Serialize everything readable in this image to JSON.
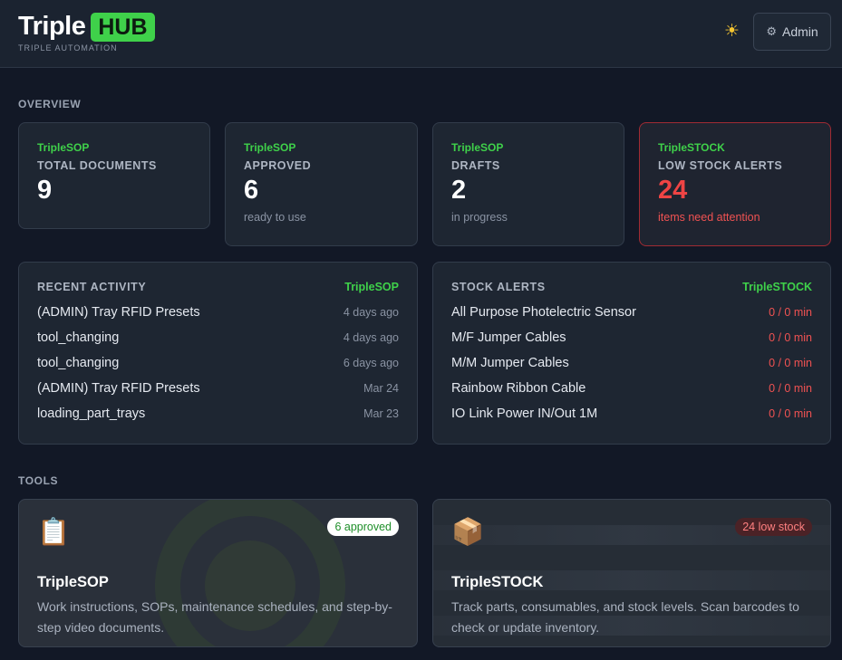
{
  "header": {
    "brand_name": "Triple",
    "brand_hub": "HUB",
    "brand_sub": "TRIPLE AUTOMATION",
    "theme_icon": "sun-icon",
    "admin_label": "Admin"
  },
  "overview": {
    "label": "OVERVIEW",
    "cards": [
      {
        "tag": "TripleSOP",
        "title": "TOTAL DOCUMENTS",
        "value": "9",
        "sub": ""
      },
      {
        "tag": "TripleSOP",
        "title": "APPROVED",
        "value": "6",
        "sub": "ready to use"
      },
      {
        "tag": "TripleSOP",
        "title": "DRAFTS",
        "value": "2",
        "sub": "in progress"
      },
      {
        "tag": "TripleSTOCK",
        "title": "LOW STOCK ALERTS",
        "value": "24",
        "sub": "items need attention"
      }
    ]
  },
  "recent": {
    "title": "RECENT ACTIVITY",
    "badge": "TripleSOP",
    "items": [
      {
        "name": "(ADMIN) Tray RFID Presets",
        "time": "4 days ago"
      },
      {
        "name": "tool_changing",
        "time": "4 days ago"
      },
      {
        "name": "tool_changing",
        "time": "6 days ago"
      },
      {
        "name": "(ADMIN) Tray RFID Presets",
        "time": "Mar 24"
      },
      {
        "name": "loading_part_trays",
        "time": "Mar 23"
      }
    ]
  },
  "stock": {
    "title": "STOCK ALERTS",
    "badge": "TripleSTOCK",
    "items": [
      {
        "name": "All Purpose Photelectric Sensor",
        "qty": "0 / 0 min"
      },
      {
        "name": "M/F Jumper Cables",
        "qty": "0 / 0 min"
      },
      {
        "name": "M/M Jumper Cables",
        "qty": "0 / 0 min"
      },
      {
        "name": "Rainbow Ribbon Cable",
        "qty": "0 / 0 min"
      },
      {
        "name": "IO Link Power IN/Out 1M",
        "qty": "0 / 0 min"
      }
    ]
  },
  "tools": {
    "label": "TOOLS",
    "sop": {
      "icon": "clipboard-icon",
      "badge": "6 approved",
      "name": "TripleSOP",
      "desc": "Work instructions, SOPs, maintenance schedules, and step-by-step video documents."
    },
    "stock": {
      "icon": "package-icon",
      "badge": "24 low stock",
      "name": "TripleSTOCK",
      "desc": "Track parts, consumables, and stock levels. Scan barcodes to check or update inventory."
    }
  },
  "colors": {
    "accent_green": "#3fd14a",
    "alert_red": "#ef4444",
    "background": "#121826"
  }
}
